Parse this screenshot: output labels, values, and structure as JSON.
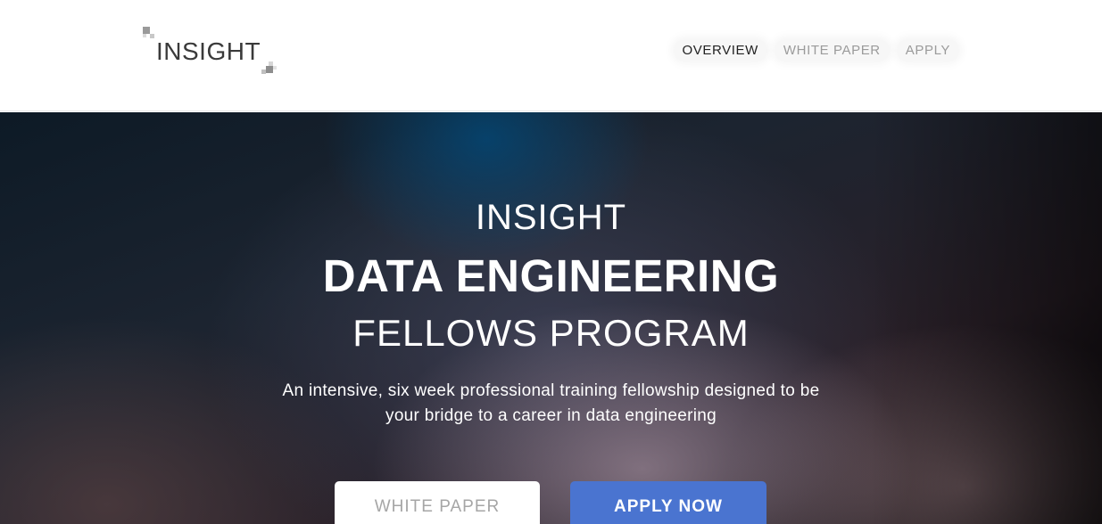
{
  "header": {
    "logo_text": "INSIGHT",
    "nav": [
      {
        "label": "OVERVIEW"
      },
      {
        "label": "WHITE PAPER"
      },
      {
        "label": "APPLY"
      }
    ]
  },
  "hero": {
    "line1": "INSIGHT",
    "line2": "DATA ENGINEERING",
    "line3": "FELLOWS PROGRAM",
    "description_line1": "An intensive, six week professional training fellowship designed to be",
    "description_line2": "your bridge to a career in data engineering",
    "buttons": {
      "white_paper": "WHITE PAPER",
      "apply_now": "APPLY NOW"
    }
  },
  "colors": {
    "accent_blue": "#4a74d0",
    "nav_active": "#222222",
    "nav_inactive": "#9b9b9b"
  }
}
